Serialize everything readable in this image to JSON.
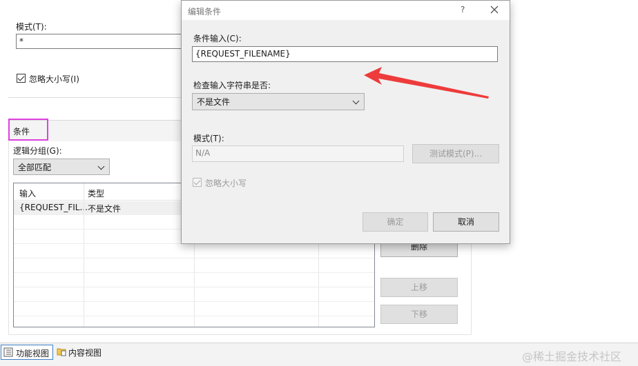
{
  "background_panel": {
    "pattern_label": "模式(T):",
    "pattern_value": "*",
    "ignore_case_label": "忽略大小写(I)",
    "conditions_header": "条件",
    "logical_group_label": "逻辑分组(G):",
    "logical_group_value": "全部匹配",
    "grid": {
      "columns": [
        "输入",
        "类型"
      ],
      "rows": [
        [
          "{REQUEST_FIL...",
          "不是文件"
        ]
      ]
    },
    "buttons": {
      "delete": "删除",
      "move_up": "上移",
      "move_down": "下移"
    }
  },
  "dialog": {
    "title": "编辑条件",
    "help": "?",
    "condition_input_label": "条件输入(C):",
    "condition_input_value": "{REQUEST_FILENAME}",
    "check_type_label": "检查输入字符串是否:",
    "check_type_value": "不是文件",
    "pattern_label": "模式(T):",
    "pattern_value": "N/A",
    "test_pattern_button": "测试模式(P)...",
    "ignore_case_label": "忽略大小写",
    "ok_button": "确定",
    "cancel_button": "取消"
  },
  "bottom_tabs": {
    "features_view": "功能视图",
    "content_view": "内容视图"
  },
  "watermark": "@稀土掘金技术社区",
  "colors": {
    "highlight_box": "#e040e0",
    "annotation_arrow": "#ee3b3b",
    "grid_selected_row": "#f0f0f0"
  }
}
